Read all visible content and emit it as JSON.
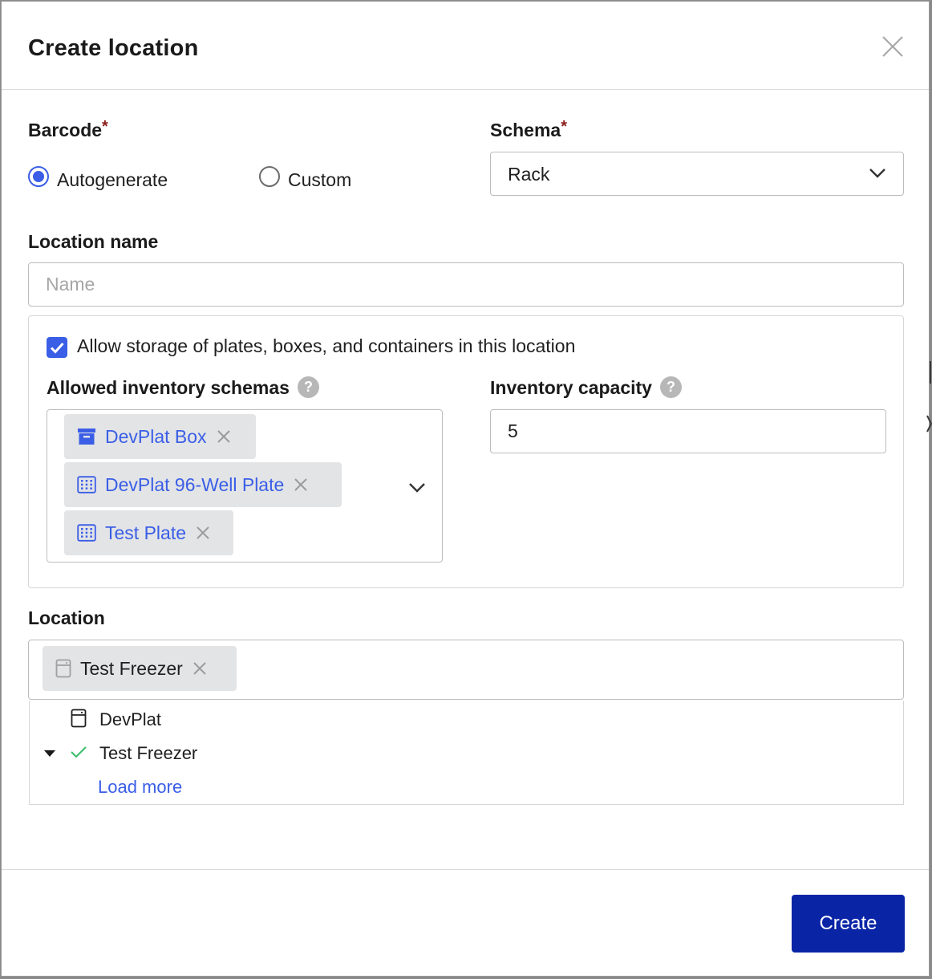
{
  "dialog": {
    "title": "Create location",
    "close_icon": "close-icon"
  },
  "barcode": {
    "label": "Barcode",
    "required_mark": "*",
    "options": [
      {
        "label": "Autogenerate",
        "selected": true
      },
      {
        "label": "Custom",
        "selected": false
      }
    ]
  },
  "schema": {
    "label": "Schema",
    "required_mark": "*",
    "value": "Rack",
    "icon": "chevron-down-icon"
  },
  "location_name": {
    "label": "Location name",
    "placeholder": "Name",
    "value": ""
  },
  "storage": {
    "allow_label": "Allow storage of plates, boxes, and containers in this location",
    "allow_checked": true,
    "schemas_label": "Allowed inventory schemas",
    "schemas_help": "?",
    "schemas": [
      {
        "label": "DevPlat Box",
        "icon": "box-icon"
      },
      {
        "label": "DevPlat 96-Well Plate",
        "icon": "plate-icon"
      },
      {
        "label": "Test Plate",
        "icon": "plate-icon"
      }
    ],
    "capacity_label": "Inventory capacity",
    "capacity_help": "?",
    "capacity_value": "5"
  },
  "location": {
    "label": "Location",
    "selected": {
      "label": "Test Freezer",
      "icon": "freezer-icon"
    },
    "tree": [
      {
        "label": "DevPlat",
        "icon": "freezer-icon"
      },
      {
        "label": "Test Freezer",
        "icon": "check-icon",
        "expander": "caret-down-icon"
      }
    ],
    "load_more": "Load more"
  },
  "footer": {
    "create_label": "Create"
  },
  "colors": {
    "accent": "#3a5ee6",
    "primary_button": "#0a24a6",
    "required": "#8a1c1c",
    "check": "#3fbf6f"
  }
}
